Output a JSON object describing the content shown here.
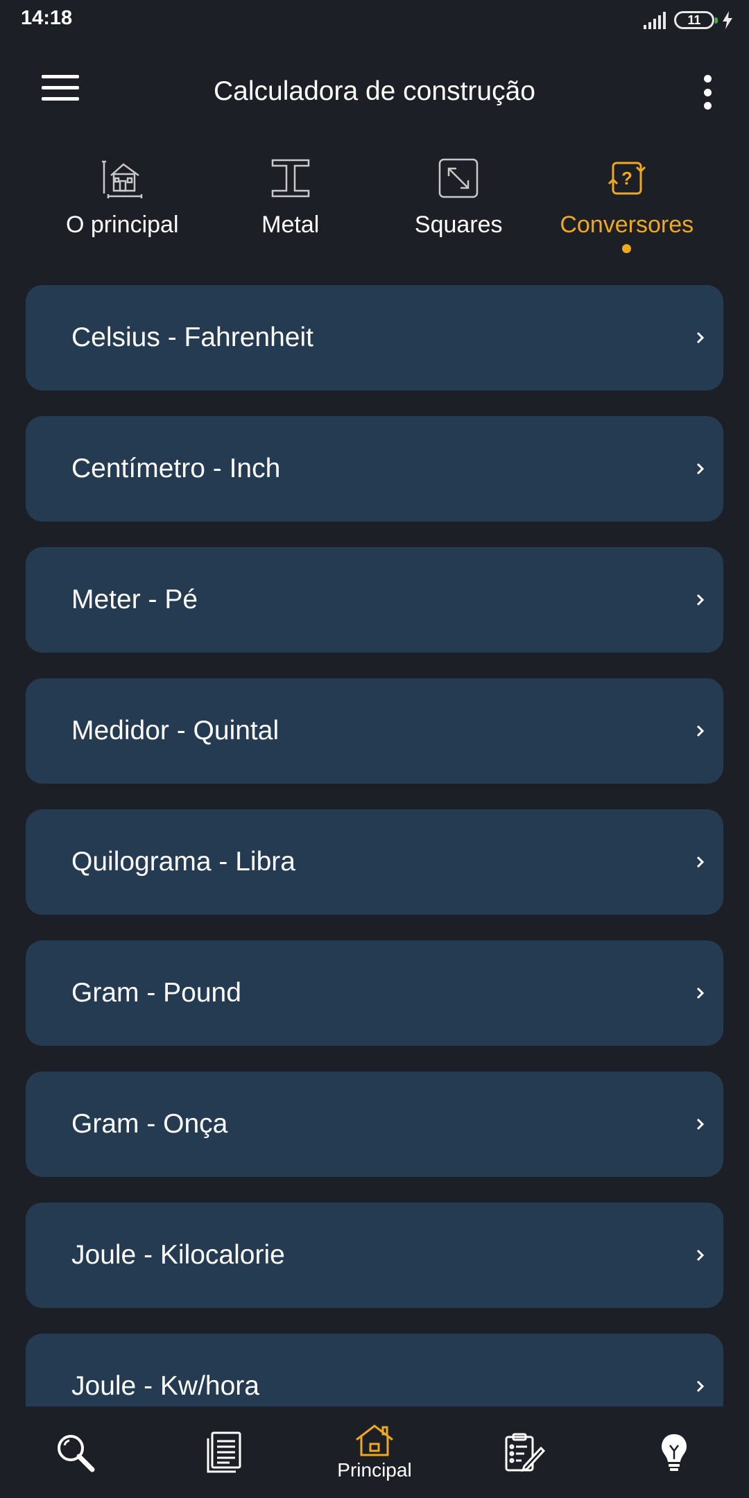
{
  "status_bar": {
    "time": "14:18",
    "battery_level": "11",
    "icons": [
      "signal-icon",
      "battery-icon",
      "charging-bolt-icon"
    ]
  },
  "app_bar": {
    "title": "Calculadora de construção",
    "icons": [
      "hamburger-menu-icon",
      "more-vertical-icon"
    ]
  },
  "tabs": [
    {
      "label": "O principal",
      "icon": "house-blueprint-icon",
      "active": false
    },
    {
      "label": "Metal",
      "icon": "i-beam-icon",
      "active": false
    },
    {
      "label": "Squares",
      "icon": "expand-diagonal-icon",
      "active": false
    },
    {
      "label": "Conversores",
      "icon": "convert-question-icon",
      "active": true
    }
  ],
  "converters": [
    {
      "label": "Celsius - Fahrenheit"
    },
    {
      "label": "Centímetro - Inch"
    },
    {
      "label": "Meter - Pé"
    },
    {
      "label": "Medidor - Quintal"
    },
    {
      "label": "Quilograma - Libra"
    },
    {
      "label": "Gram - Pound"
    },
    {
      "label": "Gram - Onça"
    },
    {
      "label": "Joule - Kilocalorie"
    },
    {
      "label": "Joule - Kw/hora"
    }
  ],
  "bottom_nav": [
    {
      "icon": "search-icon",
      "label": ""
    },
    {
      "icon": "document-list-icon",
      "label": ""
    },
    {
      "icon": "home-icon",
      "label": "Principal",
      "active": true
    },
    {
      "icon": "clipboard-edit-icon",
      "label": ""
    },
    {
      "icon": "lightbulb-icon",
      "label": ""
    }
  ],
  "colors": {
    "background": "#1c2026",
    "card": "#243b52",
    "accent": "#f0a81f",
    "text": "#ffffff"
  }
}
